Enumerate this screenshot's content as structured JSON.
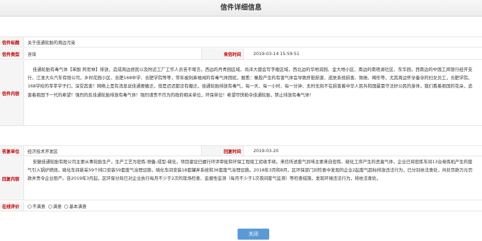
{
  "page_title": "信件详细信息",
  "fields": {
    "letter_title": {
      "label": "信件标题",
      "value": "关于佳通轮胎的周边污染"
    },
    "letter_type": {
      "label": "信件类型",
      "value": "咨询"
    },
    "received_time": {
      "label": "来信时间",
      "value": "2019-03-14 15:59:51"
    },
    "letter_content": {
      "label": "信件内容",
      "value": "佳通轮胎有毒气体【苯酚 阿尼林】排放，造成周边居民以及附近工厂工作人员苦不堪言。西边的丹青园区域、尚泽大都会写字楼区域，西北边的华地润园、金大地小区、南边的南艳湖社区、东华园，西南边的中国工商银行经开支行、江淮大众汽车有限公司，乡村花园小区、合肥168中学、合肥学院等等，常年被刺鼻难闻的有毒气体困扰，据悉：橡胶产生的有害气体会导致肝脏损害、皮肤系统损害、致癌、畸形等，尤其周边怀孕备孕的妇女员工，合肥学院、168学校的莘莘学子们，深受其害！网络上是有消息说佳通要搬迁，但是迟迟都没有搬迁，佳通轮胎排放有毒气，每一天、每一小时、每一分钟、无时无刻不在损害着中华人民共和国最需守法好公民的身体，我们看着祖国的花朵，追害着祖国下一代的希望！强烈的反佳通轮胎排放有毒气体！强烈请责不作为的政府相关单位，环保单位！希望尽快勒令佳通轮胎，禁止排放有毒气体！"
    },
    "answer_unit": {
      "label": "答复单位",
      "value": "经济技术开发区"
    },
    "reply_time": {
      "label": "回复时间",
      "value": "2019-03-20"
    },
    "reply_content": {
      "label": "回复内容",
      "value": "安徽佳通轮胎有限公司主要从事轮胎生产，生产工艺为密炼-预备-成型-硫化，项目建设已履行环评审批和环保工程竣工验收手续。来信所述废气异味主要来自密炼、硫化工序产生的恶臭气体，企业已将密炼车间13台母炼机产生的废气引入锅炉燃烧，硫化车间新采59个排口安装59套废气治理设施，硫化车间安装18套罐弃系统和36套废气治理设施。2018年3月和8月，区环保部门对检查中发现的企业2起废气超标排放违法行为，已分别依法查处，共处罚款万元罚款并责令企业限产。自2019年3月起，区环保分局已对企业执行每月不少于2次的现场检查、监督性监测（每月不少于1次夜间废气监测）等检查措施，发现环境违法行为，将依法查处。"
    },
    "evaluation": {
      "label": "在线评价",
      "options": [
        "不满意",
        "满意",
        "基本满意"
      ]
    }
  },
  "close_button": "关闭"
}
